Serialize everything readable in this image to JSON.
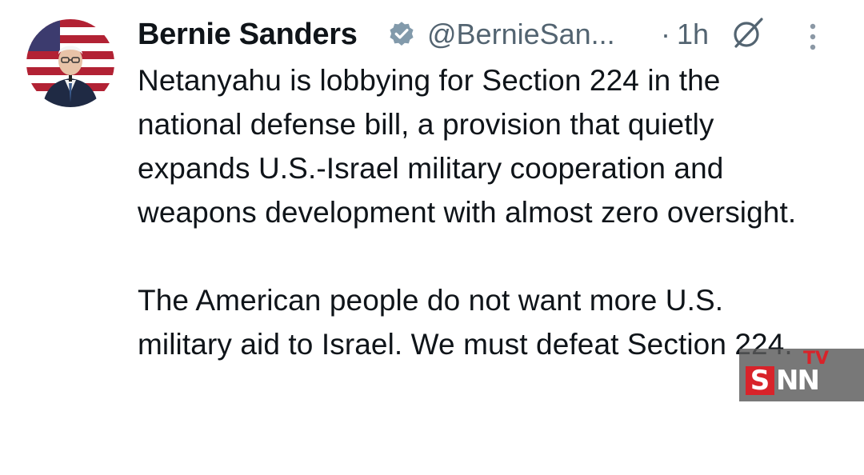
{
  "tweet": {
    "author": {
      "display_name": "Bernie Sanders",
      "handle": "@BernieSan...",
      "verified": true,
      "avatar_icon": "profile-photo"
    },
    "meta": {
      "separator": "·",
      "time": "1h"
    },
    "text": "Netanyahu is lobbying for Section 224 in the national defense bill, a provision that quietly expands U.S.-Israel military cooperation and weapons development with almost zero oversight.\n\nThe American people do not want more U.S. military aid to Israel. We must defeat Section 224.",
    "actions": {
      "grok_icon": "grok-icon",
      "more_icon": "more-options-icon"
    }
  },
  "watermark": {
    "s": "S",
    "nn": "NN",
    "tv": "TV",
    "accent": "#d8232a"
  },
  "colors": {
    "text": "#0f1419",
    "secondary": "#536471",
    "verified_badge": "#829aab"
  }
}
